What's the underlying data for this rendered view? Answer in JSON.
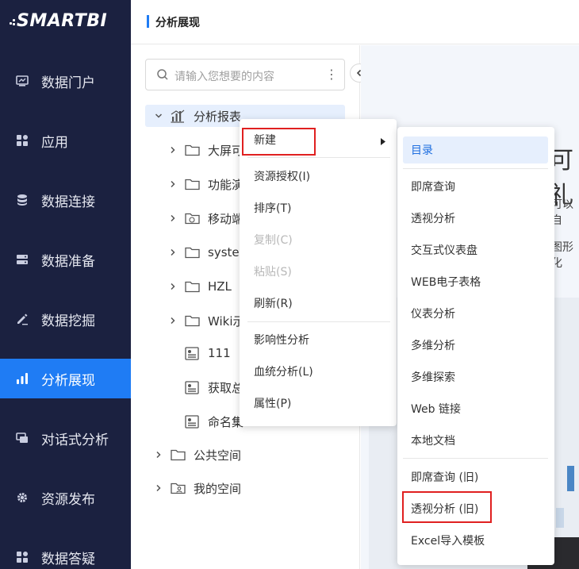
{
  "app": {
    "logo": "SMARTBI"
  },
  "nav": {
    "items": [
      {
        "label": "数据门户",
        "icon": "portal-icon"
      },
      {
        "label": "应用",
        "icon": "apps-icon"
      },
      {
        "label": "数据连接",
        "icon": "database-icon"
      },
      {
        "label": "数据准备",
        "icon": "server-icon"
      },
      {
        "label": "数据挖掘",
        "icon": "pen-icon"
      },
      {
        "label": "分析展现",
        "icon": "bar-chart-icon",
        "active": true
      },
      {
        "label": "对话式分析",
        "icon": "chat-icon"
      },
      {
        "label": "资源发布",
        "icon": "gear-icon"
      },
      {
        "label": "数据答疑",
        "icon": "qa-icon"
      }
    ]
  },
  "header": {
    "title": "分析展现"
  },
  "tree": {
    "search_placeholder": "请输入您想要的内容",
    "root": "分析报表",
    "folders": [
      "大屏可",
      "功能演",
      "移动端",
      "syster",
      "HZL",
      "Wiki示"
    ],
    "reports": [
      "111",
      "获取总",
      "命名集"
    ],
    "public_space": "公共空间",
    "my_space": "我的空间"
  },
  "content": {
    "big_text": "可礼",
    "line1": "可以自",
    "line2": "图形化"
  },
  "context_menu": {
    "new": "新建",
    "grant": "资源授权(I)",
    "sort": "排序(T)",
    "copy": "复制(C)",
    "paste": "粘贴(S)",
    "refresh": "刷新(R)",
    "impact": "影响性分析",
    "lineage": "血统分析(L)",
    "properties": "属性(P)"
  },
  "submenu": {
    "items": [
      "目录",
      "即席查询",
      "透视分析",
      "交互式仪表盘",
      "WEB电子表格",
      "仪表分析",
      "多维分析",
      "多维探索",
      "Web 链接",
      "本地文档",
      "即席查询 (旧)",
      "透视分析 (旧)",
      "Excel导入模板"
    ]
  },
  "colors": {
    "nav_bg": "#1b2140",
    "accent": "#1f7cf4",
    "highlight_box": "#e02020"
  }
}
